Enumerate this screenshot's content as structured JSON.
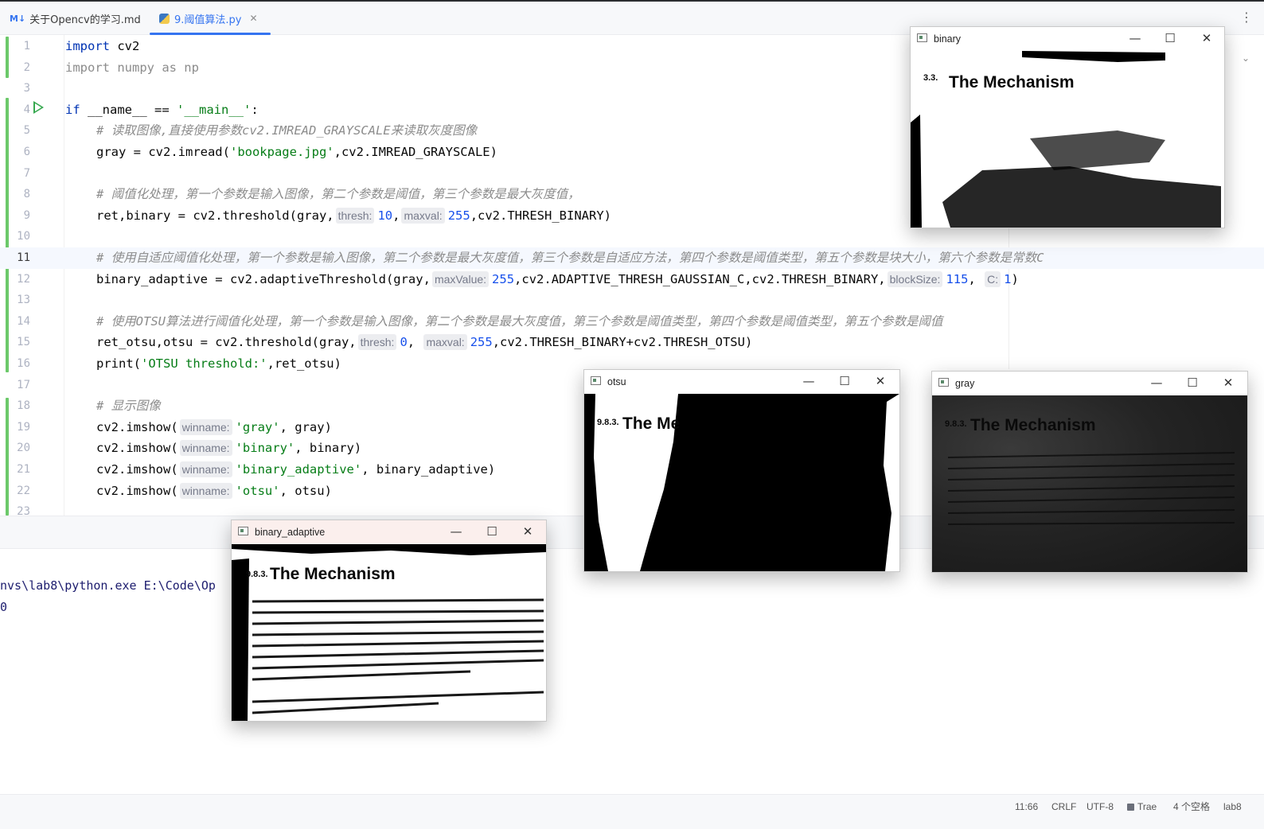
{
  "tabs": [
    {
      "icon": "M↓",
      "label": "关于Opencv的学习.md",
      "active": false
    },
    {
      "icon": "py",
      "label": "9.阈值算法.py",
      "active": true
    }
  ],
  "editor": {
    "line_numbers": [
      "1",
      "2",
      "3",
      "4",
      "5",
      "6",
      "7",
      "8",
      "9",
      "10",
      "11",
      "12",
      "13",
      "14",
      "15",
      "16",
      "17",
      "18",
      "19",
      "20",
      "21",
      "22",
      "23"
    ],
    "hints": {
      "thresh": "thresh:",
      "maxval": "maxval:",
      "maxValue": "maxValue:",
      "blockSize": "blockSize:",
      "C": "C:",
      "winname": "winname:"
    },
    "lines": {
      "l1_kw": "import",
      "l1_rest": " cv2",
      "l2": "import numpy as np",
      "l4_kw": "if",
      "l4_mid": " __name__ == ",
      "l4_str": "'__main__'",
      "l4_end": ":",
      "l5": "# 读取图像,直接使用参数cv2.IMREAD_GRAYSCALE来读取灰度图像",
      "l6_a": "gray = cv2.imread(",
      "l6_str": "'bookpage.jpg'",
      "l6_b": ",cv2.IMREAD_GRAYSCALE)",
      "l8": "# 阈值化处理，第一个参数是输入图像，第二个参数是阈值，第三个参数是最大灰度值，",
      "l9_a": "ret,binary = cv2.threshold(gray,",
      "l9_n1": "10",
      "l9_c": ",",
      "l9_n2": "255",
      "l9_b": ",cv2.THRESH_BINARY)",
      "l11": "# 使用自适应阈值化处理，第一个参数是输入图像，第二个参数是最大灰度值，第三个参数是自适应方法，第四个参数是阈值类型，第五个参数是块大小，第六个参数是常数C",
      "l12_a": "binary_adaptive = cv2.adaptiveThreshold(gray,",
      "l12_n1": "255",
      "l12_b": ",cv2.ADAPTIVE_THRESH_GAUSSIAN_C,cv2.THRESH_BINARY,",
      "l12_n2": "115",
      "l12_c": ", ",
      "l12_n3": "1",
      "l12_d": ")",
      "l14": "# 使用OTSU算法进行阈值化处理，第一个参数是输入图像，第二个参数是最大灰度值，第三个参数是阈值类型，第四个参数是阈值类型，第五个参数是阈值",
      "l15_a": "ret_otsu,otsu = cv2.threshold(gray,",
      "l15_n1": "0",
      "l15_c": ", ",
      "l15_n2": "255",
      "l15_b": ",cv2.THRESH_BINARY+cv2.THRESH_OTSU)",
      "l16_a": "print(",
      "l16_str": "'OTSU threshold:'",
      "l16_b": ",ret_otsu)",
      "l18": "# 显示图像",
      "l19_a": "cv2.imshow(",
      "l19_str": "'gray'",
      "l19_b": ", gray)",
      "l20_a": "cv2.imshow(",
      "l20_str": "'binary'",
      "l20_b": ", binary)",
      "l21_a": "cv2.imshow(",
      "l21_str": "'binary_adaptive'",
      "l21_b": ", binary_adaptive)",
      "l22_a": "cv2.imshow(",
      "l22_str": "'otsu'",
      "l22_b": ", otsu)"
    }
  },
  "console": {
    "line1": "nvs\\lab8\\python.exe E:\\Code\\Op",
    "line2": "0"
  },
  "windows": {
    "binary": {
      "title": "binary",
      "heading_prefix": "3.3.",
      "heading": "The Mechanism"
    },
    "otsu": {
      "title": "otsu",
      "heading_prefix": "9.8.3.",
      "heading": "The Me"
    },
    "gray": {
      "title": "gray",
      "heading_prefix": "9.8.3.",
      "heading": "The Mechanism"
    },
    "binary_adaptive": {
      "title": "binary_adaptive",
      "heading_prefix": "9.8.3.",
      "heading": "The Mechanism"
    }
  },
  "window_controls": {
    "minimize": "—",
    "maximize": "☐",
    "close": "✕"
  },
  "statusbar": {
    "position": "11:66",
    "line_ending": "CRLF",
    "encoding": "UTF-8",
    "interpreter": "Trae",
    "indent": "4 个空格",
    "project": "lab8"
  },
  "colors": {
    "accent": "#3574f0",
    "keyword": "#0033b3",
    "string": "#067d17",
    "number": "#1750eb",
    "comment": "#8c8c8c"
  }
}
